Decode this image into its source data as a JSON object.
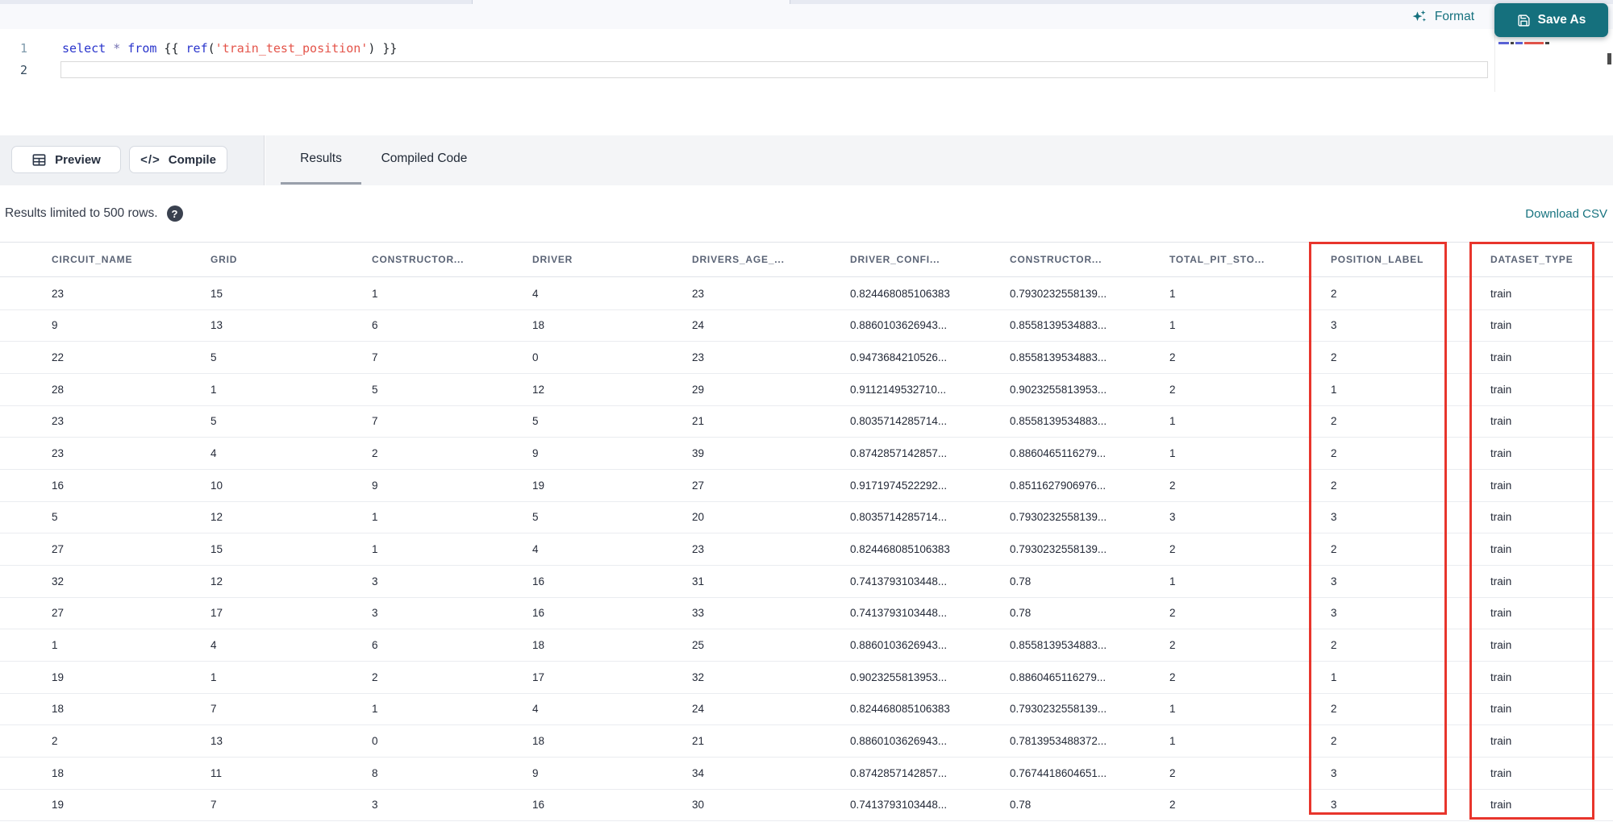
{
  "app": {
    "accent_teal": "#15707d",
    "highlight_red": "#e8352c"
  },
  "editor": {
    "line_numbers": [
      "1",
      "2"
    ],
    "code_line": [
      {
        "type": "keyword",
        "text": "select"
      },
      {
        "type": "plain",
        "text": " "
      },
      {
        "type": "operator",
        "text": "*"
      },
      {
        "type": "plain",
        "text": " "
      },
      {
        "type": "keyword",
        "text": "from"
      },
      {
        "type": "plain",
        "text": " {{ "
      },
      {
        "type": "keyword",
        "text": "ref"
      },
      {
        "type": "plain",
        "text": "("
      },
      {
        "type": "string",
        "text": "'train_test_position'"
      },
      {
        "type": "plain",
        "text": ") }}"
      }
    ],
    "format_label": "Format",
    "save_as_label": "Save As"
  },
  "toolbar": {
    "preview_label": "Preview",
    "compile_label": "Compile",
    "compile_glyph": "</>",
    "tabs": [
      {
        "label": "Results",
        "active": true
      },
      {
        "label": "Compiled Code",
        "active": false
      }
    ]
  },
  "results_bar": {
    "message": "Results limited to 500 rows.",
    "help_glyph": "?",
    "download_label": "Download CSV"
  },
  "table": {
    "columns": [
      "CIRCUIT_NAME",
      "GRID",
      "CONSTRUCTOR...",
      "DRIVER",
      "DRIVERS_AGE_...",
      "DRIVER_CONFI...",
      "CONSTRUCTOR...",
      "TOTAL_PIT_STO...",
      "POSITION_LABEL",
      "DATASET_TYPE"
    ],
    "highlighted_columns": [
      "POSITION_LABEL",
      "DATASET_TYPE"
    ],
    "rows": [
      [
        "23",
        "15",
        "1",
        "4",
        "23",
        "0.824468085106383",
        "0.7930232558139...",
        "1",
        "2",
        "train"
      ],
      [
        "9",
        "13",
        "6",
        "18",
        "24",
        "0.8860103626943...",
        "0.8558139534883...",
        "1",
        "3",
        "train"
      ],
      [
        "22",
        "5",
        "7",
        "0",
        "23",
        "0.9473684210526...",
        "0.8558139534883...",
        "2",
        "2",
        "train"
      ],
      [
        "28",
        "1",
        "5",
        "12",
        "29",
        "0.9112149532710...",
        "0.9023255813953...",
        "2",
        "1",
        "train"
      ],
      [
        "23",
        "5",
        "7",
        "5",
        "21",
        "0.8035714285714...",
        "0.8558139534883...",
        "1",
        "2",
        "train"
      ],
      [
        "23",
        "4",
        "2",
        "9",
        "39",
        "0.8742857142857...",
        "0.8860465116279...",
        "1",
        "2",
        "train"
      ],
      [
        "16",
        "10",
        "9",
        "19",
        "27",
        "0.9171974522292...",
        "0.8511627906976...",
        "2",
        "2",
        "train"
      ],
      [
        "5",
        "12",
        "1",
        "5",
        "20",
        "0.8035714285714...",
        "0.7930232558139...",
        "3",
        "3",
        "train"
      ],
      [
        "27",
        "15",
        "1",
        "4",
        "23",
        "0.824468085106383",
        "0.7930232558139...",
        "2",
        "2",
        "train"
      ],
      [
        "32",
        "12",
        "3",
        "16",
        "31",
        "0.7413793103448...",
        "0.78",
        "1",
        "3",
        "train"
      ],
      [
        "27",
        "17",
        "3",
        "16",
        "33",
        "0.7413793103448...",
        "0.78",
        "2",
        "3",
        "train"
      ],
      [
        "1",
        "4",
        "6",
        "18",
        "25",
        "0.8860103626943...",
        "0.8558139534883...",
        "2",
        "2",
        "train"
      ],
      [
        "19",
        "1",
        "2",
        "17",
        "32",
        "0.9023255813953...",
        "0.8860465116279...",
        "2",
        "1",
        "train"
      ],
      [
        "18",
        "7",
        "1",
        "4",
        "24",
        "0.824468085106383",
        "0.7930232558139...",
        "1",
        "2",
        "train"
      ],
      [
        "2",
        "13",
        "0",
        "18",
        "21",
        "0.8860103626943...",
        "0.7813953488372...",
        "1",
        "2",
        "train"
      ],
      [
        "18",
        "11",
        "8",
        "9",
        "34",
        "0.8742857142857...",
        "0.7674418604651...",
        "2",
        "3",
        "train"
      ],
      [
        "19",
        "7",
        "3",
        "16",
        "30",
        "0.7413793103448...",
        "0.78",
        "2",
        "3",
        "train"
      ]
    ]
  }
}
